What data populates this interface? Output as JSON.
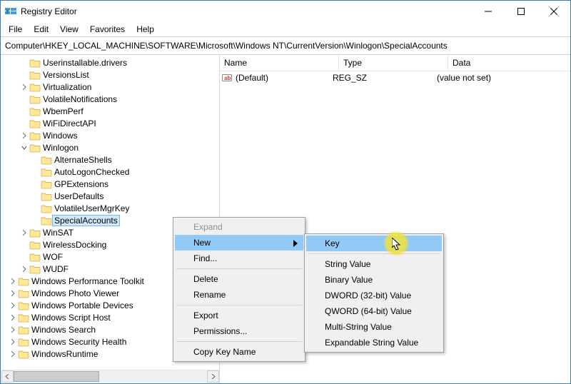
{
  "titlebar": {
    "title": "Registry Editor"
  },
  "menubar": {
    "file": "File",
    "edit": "Edit",
    "view": "View",
    "favorites": "Favorites",
    "help": "Help"
  },
  "addressbar": {
    "path": "Computer\\HKEY_LOCAL_MACHINE\\SOFTWARE\\Microsoft\\Windows NT\\CurrentVersion\\Winlogon\\SpecialAccounts"
  },
  "tree": {
    "items": [
      {
        "indent": 7,
        "twisty": "",
        "label": "Userinstallable.drivers"
      },
      {
        "indent": 7,
        "twisty": "",
        "label": "VersionsList"
      },
      {
        "indent": 7,
        "twisty": ">",
        "label": "Virtualization"
      },
      {
        "indent": 7,
        "twisty": "",
        "label": "VolatileNotifications"
      },
      {
        "indent": 7,
        "twisty": "",
        "label": "WbemPerf"
      },
      {
        "indent": 7,
        "twisty": "",
        "label": "WiFiDirectAPI"
      },
      {
        "indent": 7,
        "twisty": ">",
        "label": "Windows"
      },
      {
        "indent": 7,
        "twisty": "v",
        "label": "Winlogon"
      },
      {
        "indent": 8,
        "twisty": "",
        "label": "AlternateShells"
      },
      {
        "indent": 8,
        "twisty": "",
        "label": "AutoLogonChecked"
      },
      {
        "indent": 8,
        "twisty": "",
        "label": "GPExtensions"
      },
      {
        "indent": 8,
        "twisty": "",
        "label": "UserDefaults"
      },
      {
        "indent": 8,
        "twisty": "",
        "label": "VolatileUserMgrKey"
      },
      {
        "indent": 8,
        "twisty": "",
        "label": "SpecialAccounts",
        "selected": true
      },
      {
        "indent": 7,
        "twisty": ">",
        "label": "WinSAT"
      },
      {
        "indent": 7,
        "twisty": "",
        "label": "WirelessDocking"
      },
      {
        "indent": 7,
        "twisty": "",
        "label": "WOF"
      },
      {
        "indent": 7,
        "twisty": ">",
        "label": "WUDF"
      },
      {
        "indent": 6,
        "twisty": ">",
        "label": "Windows Performance Toolkit"
      },
      {
        "indent": 6,
        "twisty": ">",
        "label": "Windows Photo Viewer"
      },
      {
        "indent": 6,
        "twisty": ">",
        "label": "Windows Portable Devices"
      },
      {
        "indent": 6,
        "twisty": ">",
        "label": "Windows Script Host"
      },
      {
        "indent": 6,
        "twisty": ">",
        "label": "Windows Search"
      },
      {
        "indent": 6,
        "twisty": ">",
        "label": "Windows Security Health"
      },
      {
        "indent": 6,
        "twisty": ">",
        "label": "WindowsRuntime"
      }
    ]
  },
  "list": {
    "columns": {
      "name": "Name",
      "type": "Type",
      "data": "Data"
    },
    "rows": [
      {
        "name": "(Default)",
        "type": "REG_SZ",
        "data": "(value not set)"
      }
    ]
  },
  "context_menu": {
    "expand": "Expand",
    "new": "New",
    "find": "Find...",
    "delete": "Delete",
    "rename": "Rename",
    "export": "Export",
    "permissions": "Permissions...",
    "copy_key_name": "Copy Key Name"
  },
  "submenu": {
    "key": "Key",
    "string": "String Value",
    "binary": "Binary Value",
    "dword": "DWORD (32-bit) Value",
    "qword": "QWORD (64-bit) Value",
    "multi": "Multi-String Value",
    "expand": "Expandable String Value"
  }
}
